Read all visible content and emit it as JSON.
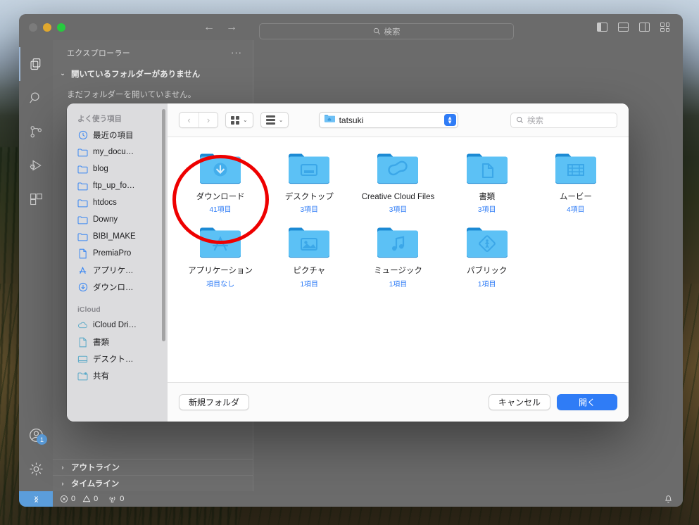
{
  "vscode": {
    "window_controls": [
      "close",
      "minimize",
      "zoom"
    ],
    "nav_back": "←",
    "nav_forward": "→",
    "search_placeholder": "検索",
    "layout_icons": [
      "toggle-primary-sidebar",
      "toggle-panel",
      "toggle-secondary-sidebar",
      "customize-layout"
    ],
    "activity_items": [
      {
        "name": "explorer",
        "label": "エクスプローラー"
      },
      {
        "name": "search",
        "label": "検索"
      },
      {
        "name": "source-control",
        "label": "ソース管理"
      },
      {
        "name": "run-debug",
        "label": "実行とデバッグ"
      },
      {
        "name": "extensions",
        "label": "拡張機能"
      }
    ],
    "account_badge": "1",
    "sidebar": {
      "title": "エクスプローラー",
      "more_actions": "···",
      "no_folder_section": "開いているフォルダーがありません",
      "no_folder_note": "まだフォルダーを開いていません。",
      "outline": "アウトライン",
      "timeline": "タイムライン"
    },
    "statusbar": {
      "remote_icon": "remote-indicator",
      "errors": "0",
      "warnings": "0",
      "ports": "0",
      "bell": "notifications-bell"
    }
  },
  "dialog": {
    "toolbar": {
      "back": "‹",
      "forward": "›",
      "icon_view_icon": "grid-view-icon",
      "arrange_icon": "group-items-icon",
      "path_label": "tatsuki",
      "search_placeholder": "検索"
    },
    "sidebar": {
      "groups": [
        {
          "title": "よく使う項目",
          "items": [
            {
              "label": "最近の項目",
              "icon": "recents-clock-icon"
            },
            {
              "label": "my_docu…",
              "icon": "folder-icon"
            },
            {
              "label": "blog",
              "icon": "folder-icon"
            },
            {
              "label": "ftp_up_fo…",
              "icon": "folder-icon"
            },
            {
              "label": "htdocs",
              "icon": "folder-icon"
            },
            {
              "label": "Downy",
              "icon": "folder-icon"
            },
            {
              "label": "BIBI_MAKE",
              "icon": "folder-icon"
            },
            {
              "label": "PremiaPro",
              "icon": "document-icon"
            },
            {
              "label": "アプリケ…",
              "icon": "applications-icon"
            },
            {
              "label": "ダウンロ…",
              "icon": "downloads-icon"
            }
          ]
        },
        {
          "title": "iCloud",
          "items": [
            {
              "label": "iCloud Dri…",
              "icon": "icloud-icon"
            },
            {
              "label": "書類",
              "icon": "document-icon"
            },
            {
              "label": "デスクト…",
              "icon": "desktop-icon"
            },
            {
              "label": "共有",
              "icon": "shared-folder-icon"
            }
          ]
        }
      ]
    },
    "items": [
      {
        "name": "ダウンロード",
        "count": "41項目",
        "icon": "downloads-folder"
      },
      {
        "name": "デスクトップ",
        "count": "3項目",
        "icon": "desktop-folder"
      },
      {
        "name": "Creative Cloud Files",
        "count": "3項目",
        "icon": "creative-cloud-folder"
      },
      {
        "name": "書類",
        "count": "3項目",
        "icon": "documents-folder"
      },
      {
        "name": "ムービー",
        "count": "4項目",
        "icon": "movies-folder"
      },
      {
        "name": "アプリケーション",
        "count": "項目なし",
        "icon": "applications-folder"
      },
      {
        "name": "ピクチャ",
        "count": "1項目",
        "icon": "pictures-folder"
      },
      {
        "name": "ミュージック",
        "count": "1項目",
        "icon": "music-folder"
      },
      {
        "name": "パブリック",
        "count": "1項目",
        "icon": "public-folder"
      }
    ],
    "footer": {
      "new_folder": "新規フォルダ",
      "cancel": "キャンセル",
      "open": "開く"
    }
  },
  "annotation": {
    "shape": "ellipse",
    "color": "#ee0000",
    "targets": "ダウンロード"
  }
}
